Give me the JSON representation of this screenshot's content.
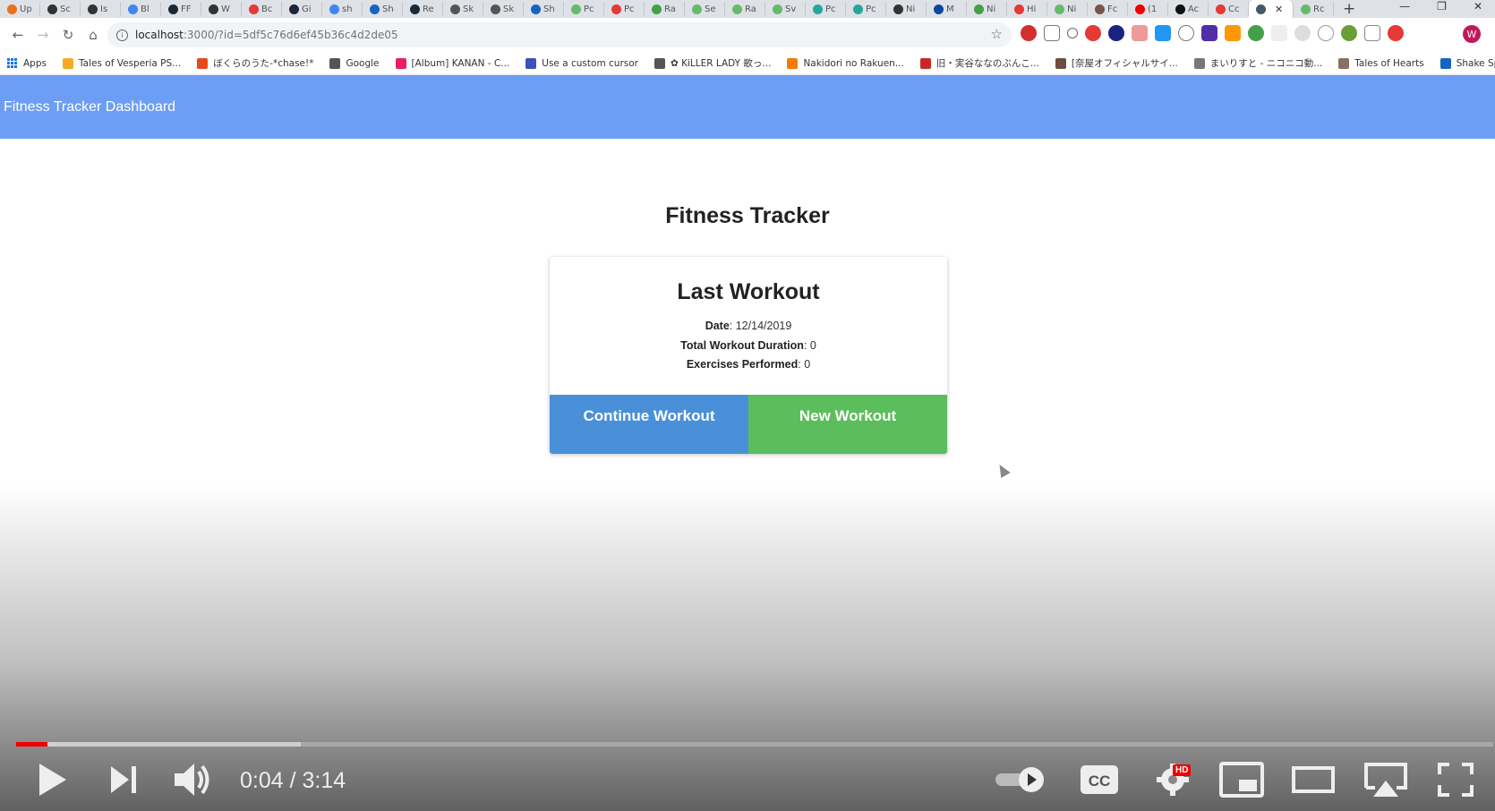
{
  "browser": {
    "tabs": [
      "Up",
      "Sc",
      "Is",
      "Bl",
      "FF",
      "W",
      "Bc",
      "Gi",
      "sh",
      "Sh",
      "Re",
      "Sk",
      "Sk",
      "Sh",
      "Pc",
      "Pc",
      "Ra",
      "Se",
      "Ra",
      "Sv",
      "Pc",
      "Pc",
      "Ni",
      "M",
      "Ni",
      "Hi",
      "Ni",
      "Fc",
      "(1",
      "Ac",
      "Cc",
      "",
      "Rc"
    ],
    "active_tab_index": 31,
    "url_host": "localhost",
    "url_path": ":3000/?id=5df5c76d6ef45b36c4d2de05",
    "profile_initial": "W",
    "bookmarks": [
      "Apps",
      "Tales of Vesperia PS...",
      "ぼくらのうた-*chase!*",
      "Google",
      "[Album] KANAN - C...",
      "Use a custom cursor",
      "✿ KiLLER LADY 歌っ...",
      "Nakidori no Rakuen...",
      "旧・実谷ななのぶんこ...",
      "[奈屋オフィシャルサイ...",
      "まいりすと - ニコニコ動...",
      "Tales of Hearts",
      "Shake Sphere log s..."
    ]
  },
  "app": {
    "navbar_title": "Fitness Tracker Dashboard",
    "page_title": "Fitness Tracker",
    "card": {
      "heading": "Last Workout",
      "date_label": "Date",
      "date_value": "12/14/2019",
      "duration_label": "Total Workout Duration",
      "duration_value": "0",
      "exercises_label": "Exercises Performed",
      "exercises_value": "0"
    },
    "continue_label": "Continue Workout",
    "new_label": "New Workout"
  },
  "player": {
    "time_display": "0:04 / 3:14",
    "played_fraction": 0.021,
    "buffered_fraction": 0.193,
    "quality_badge": "HD"
  },
  "colors": {
    "navbar": "#6d9ef5",
    "continue_button": "#4a90d9",
    "new_button": "#5cbd5c",
    "progress_played": "#ee0000"
  }
}
